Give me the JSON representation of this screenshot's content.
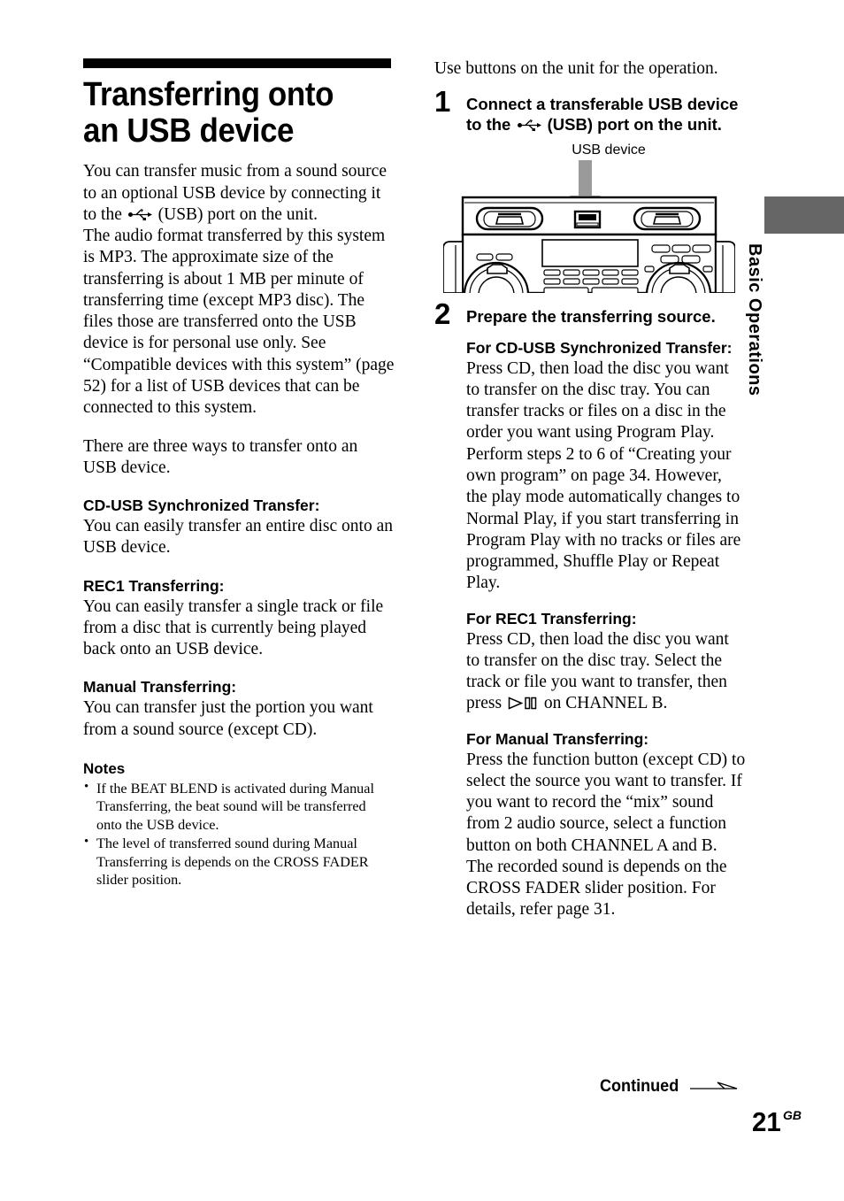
{
  "page": {
    "number": "21",
    "number_suffix": "GB",
    "continued_label": "Continued",
    "side_tab_label": "Basic Operations",
    "side_tab_color": "#666666"
  },
  "left_column": {
    "title": "Transferring onto an USB device",
    "intro_paragraph_1": "You can transfer music from a sound source to an optional USB device by connecting it to the ",
    "intro_paragraph_1b": " (USB) port on the unit.",
    "intro_paragraph_2": "The audio format transferred by this system is MP3. The approximate size of the transferring is about 1 MB per minute of transferring time (except MP3 disc). The files those are transferred onto the USB device is for personal use only. See “Compatible devices with this system” (page 52) for a list of USB devices that can be connected to this system.",
    "intro_paragraph_3": "There are three ways to transfer onto an USB device.",
    "sections": [
      {
        "heading": "CD-USB Synchronized Transfer:",
        "body": "You can easily transfer an entire disc onto an USB device."
      },
      {
        "heading": "REC1 Transferring:",
        "body": "You can easily transfer a single track or file from a disc that is currently being played back onto an USB device."
      },
      {
        "heading": "Manual Transferring:",
        "body": "You can transfer just the portion you want from a sound source (except CD)."
      }
    ],
    "notes": {
      "heading": "Notes",
      "bullet": "•",
      "items": [
        "If the BEAT BLEND is activated during Manual Transferring, the beat sound will be transferred onto the USB device.",
        "The level of transferred sound during Manual Transferring is depends on the CROSS FADER slider position."
      ]
    }
  },
  "right_column": {
    "intro_line": "Use buttons on the unit for the operation.",
    "steps": [
      {
        "number": "1",
        "text_a": "Connect a transferable USB device to the ",
        "text_b": " (USB) port on the unit."
      },
      {
        "number": "2",
        "text_a": "Prepare the transferring source.",
        "text_b": ""
      }
    ],
    "figure": {
      "caption": "USB device",
      "alt_name": "stereo-unit-usb-port-diagram",
      "arrow_color": "#999999"
    },
    "sections": [
      {
        "heading": "For CD-USB Synchronized Transfer:",
        "body": "Press CD, then load the disc you want to transfer on the disc tray. You can transfer tracks or files on a disc in the order you want using Program Play. Perform steps 2 to 6 of “Creating your own program” on page 34. However, the play mode automatically changes to Normal Play, if you start transferring in Program Play with no tracks or files are programmed, Shuffle Play or Repeat Play."
      },
      {
        "heading": "For REC1 Transferring:",
        "body_a": "Press CD, then load the disc you want to transfer on the disc tray. Select the track or file you want to transfer, then press ",
        "body_b": " on CHANNEL B."
      },
      {
        "heading": "For Manual Transferring:",
        "body": "Press the function button (except CD) to select the source you want to transfer. If you want to record the “mix” sound from 2 audio source, select a function button on both CHANNEL A and B. The recorded sound is depends on the CROSS FADER slider position. For details, refer page 31."
      }
    ]
  }
}
